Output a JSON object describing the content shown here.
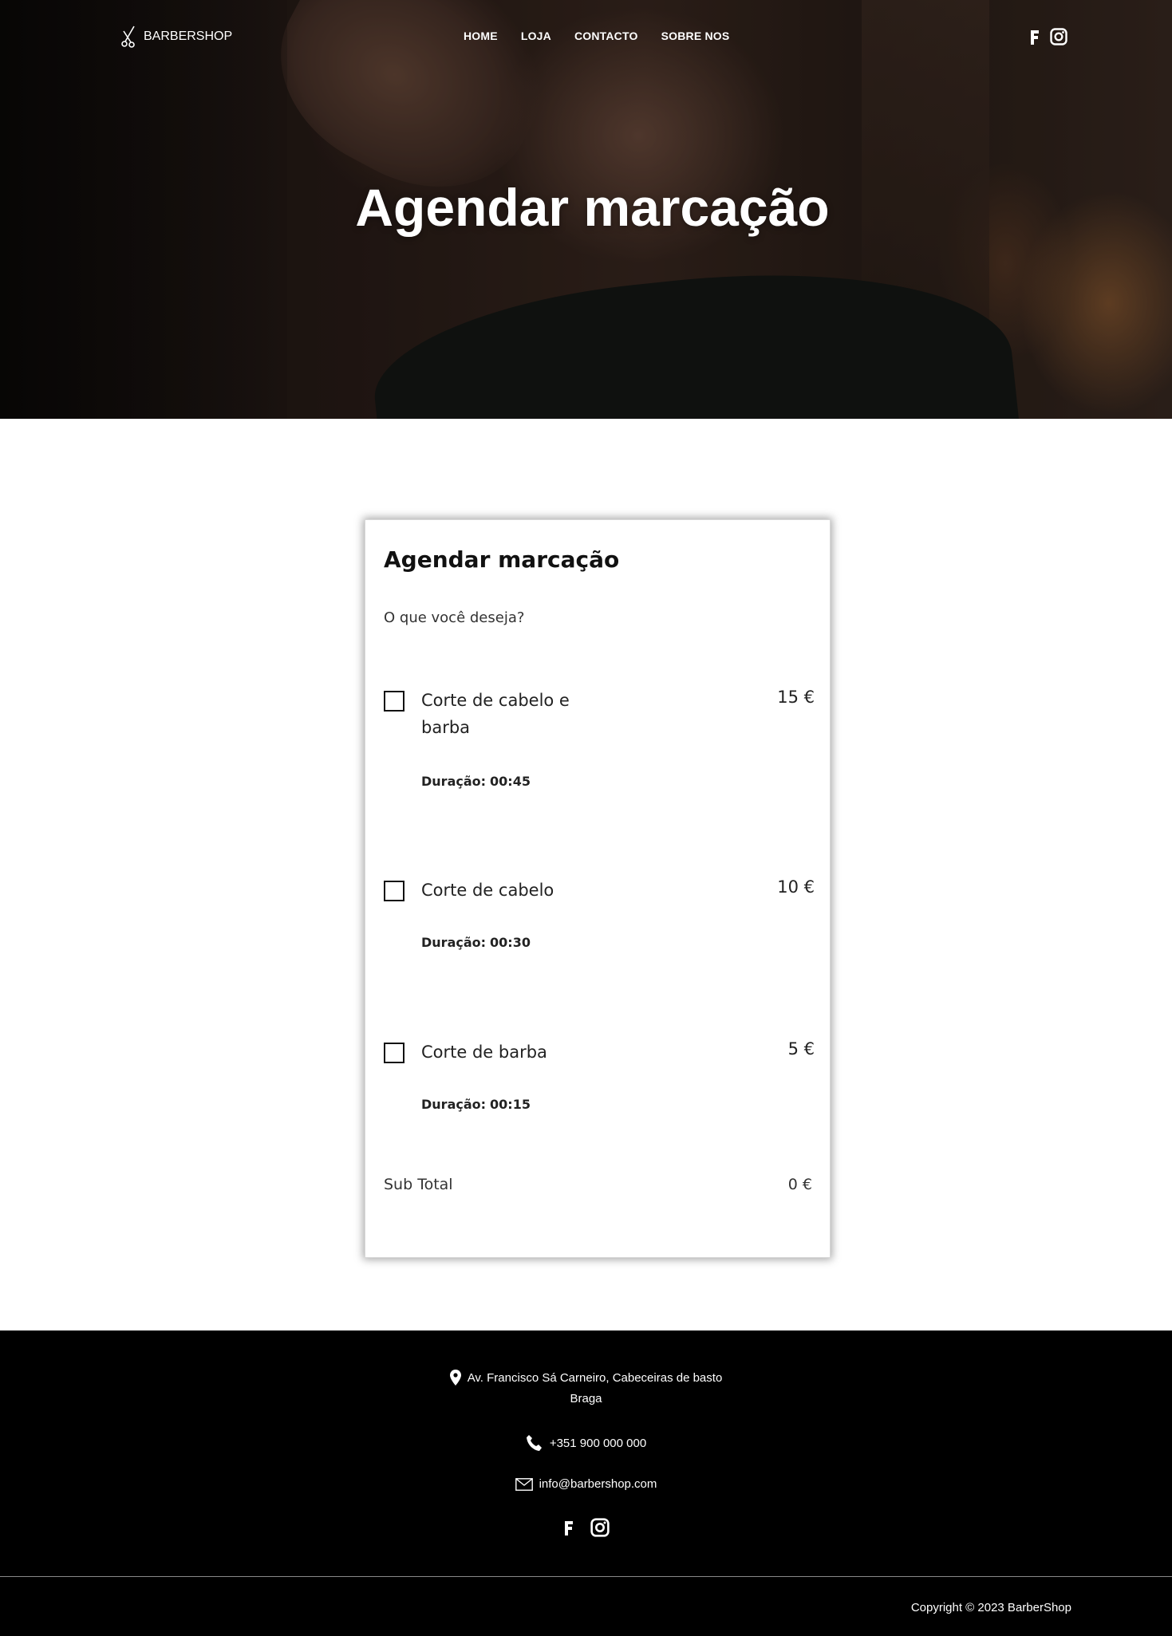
{
  "header": {
    "logo_text": "BARBERSHOP",
    "nav": [
      {
        "label": "HOME"
      },
      {
        "label": "LOJA"
      },
      {
        "label": "CONTACTO"
      },
      {
        "label": "SOBRE NOS"
      }
    ],
    "social_icons": [
      "facebook-icon",
      "instagram-icon"
    ]
  },
  "hero": {
    "title": "Agendar marcação"
  },
  "booking": {
    "title": "Agendar marcação",
    "question": "O que você deseja?",
    "duration_label": "Duração:",
    "services": [
      {
        "name": "Corte de cabelo e barba",
        "price": "15 €",
        "duration": "00:45",
        "checked": false
      },
      {
        "name": "Corte de cabelo",
        "price": "10 €",
        "duration": "00:30",
        "checked": false
      },
      {
        "name": "Corte de barba",
        "price": "5 €",
        "duration": "00:15",
        "checked": false
      }
    ],
    "subtotal_label": "Sub Total",
    "subtotal_value": "0 €"
  },
  "footer": {
    "address_line1": "Av. Francisco Sá Carneiro, Cabeceiras de basto",
    "address_line2": "Braga",
    "phone": "+351 900 000 000",
    "email": "info@barbershop.com",
    "social_icons": [
      "facebook-icon",
      "instagram-icon"
    ],
    "copyright": "Copyright © 2023 BarberShop"
  }
}
